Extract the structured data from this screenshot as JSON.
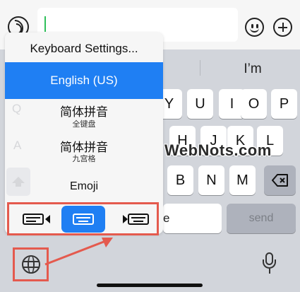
{
  "composer": {
    "input_value": "",
    "icons": {
      "voice": "voice-waves-icon",
      "emoji": "smiley-icon",
      "plus": "plus-circle-icon"
    }
  },
  "suggestion_bar": {
    "suggestion": "I’m"
  },
  "keyboard": {
    "row1_visible": [
      "Y",
      "U",
      "I",
      "O",
      "P"
    ],
    "row2_visible": [
      "H",
      "J",
      "K",
      "L"
    ],
    "row3_visible": [
      "B",
      "N",
      "M"
    ],
    "backspace_icon": "backspace-icon",
    "space_fragment": "e",
    "send_label": "send",
    "globe_icon": "globe-icon",
    "mic_icon": "microphone-icon"
  },
  "popup": {
    "settings_label": "Keyboard Settings...",
    "languages": [
      {
        "name": "English (US)",
        "sub": "",
        "selected": true
      },
      {
        "name": "简体拼音",
        "sub": "全键盘",
        "selected": false
      },
      {
        "name": "简体拼音",
        "sub": "九宫格",
        "selected": false
      },
      {
        "name": "Emoji",
        "sub": "",
        "selected": false
      }
    ],
    "ghost_keys": [
      "Q",
      "A"
    ],
    "layout_options": [
      {
        "name": "left-handed",
        "selected": false
      },
      {
        "name": "full",
        "selected": true
      },
      {
        "name": "right-handed",
        "selected": false
      }
    ]
  },
  "annotations": {
    "highlight_color": "#e45a4e",
    "accent_color": "#1f7ff3"
  },
  "watermark": "WebNots.com"
}
